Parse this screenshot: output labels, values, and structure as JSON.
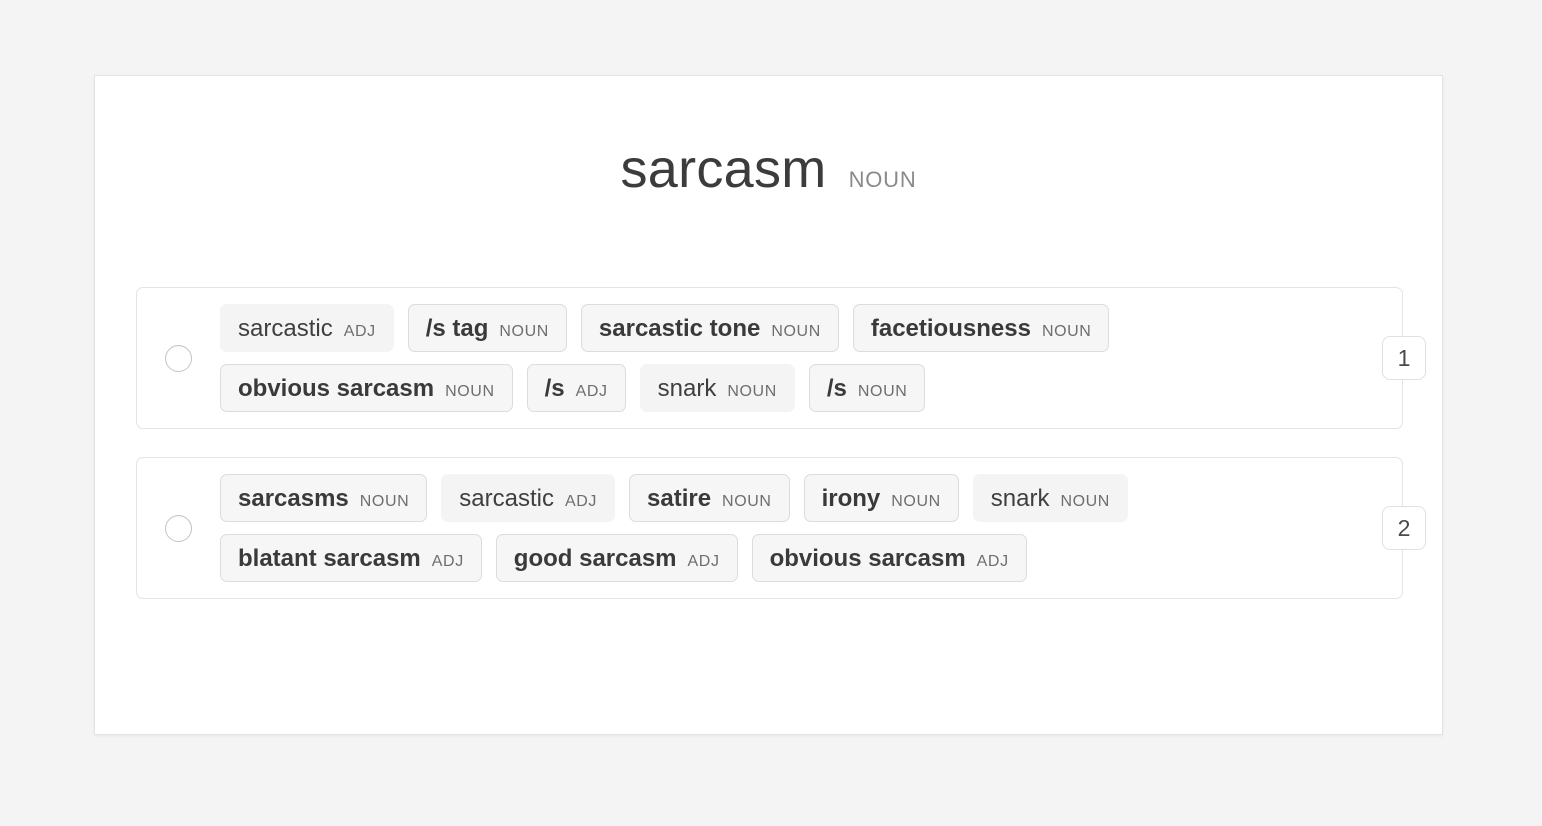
{
  "entry": {
    "headword": "sarcasm",
    "part_of_speech": "NOUN"
  },
  "colors": {
    "page_background": "#f4f4f4",
    "card_background": "#ffffff",
    "card_border": "#e3e3e3",
    "group_border": "#e4e4e4",
    "tag_background": "#f4f4f4",
    "tag_bordered_background": "#f6f6f6",
    "tag_border": "#dcdcdc",
    "text_primary": "#3c3c3c",
    "text_muted": "#8a8a8a"
  },
  "senses": [
    {
      "number": "1",
      "selected": false,
      "tags": [
        {
          "word": "sarcastic",
          "pos": "ADJ",
          "bordered": false
        },
        {
          "word": "/s tag",
          "pos": "NOUN",
          "bordered": true
        },
        {
          "word": "sarcastic tone",
          "pos": "NOUN",
          "bordered": true
        },
        {
          "word": "facetiousness",
          "pos": "NOUN",
          "bordered": true
        },
        {
          "word": "obvious sarcasm",
          "pos": "NOUN",
          "bordered": true
        },
        {
          "word": "/s",
          "pos": "ADJ",
          "bordered": true
        },
        {
          "word": "snark",
          "pos": "NOUN",
          "bordered": false
        },
        {
          "word": "/s",
          "pos": "NOUN",
          "bordered": true
        }
      ]
    },
    {
      "number": "2",
      "selected": false,
      "tags": [
        {
          "word": "sarcasms",
          "pos": "NOUN",
          "bordered": true
        },
        {
          "word": "sarcastic",
          "pos": "ADJ",
          "bordered": false
        },
        {
          "word": "satire",
          "pos": "NOUN",
          "bordered": true
        },
        {
          "word": "irony",
          "pos": "NOUN",
          "bordered": true
        },
        {
          "word": "snark",
          "pos": "NOUN",
          "bordered": false
        },
        {
          "word": "blatant sarcasm",
          "pos": "ADJ",
          "bordered": true
        },
        {
          "word": "good sarcasm",
          "pos": "ADJ",
          "bordered": true
        },
        {
          "word": "obvious sarcasm",
          "pos": "ADJ",
          "bordered": true
        }
      ]
    }
  ]
}
